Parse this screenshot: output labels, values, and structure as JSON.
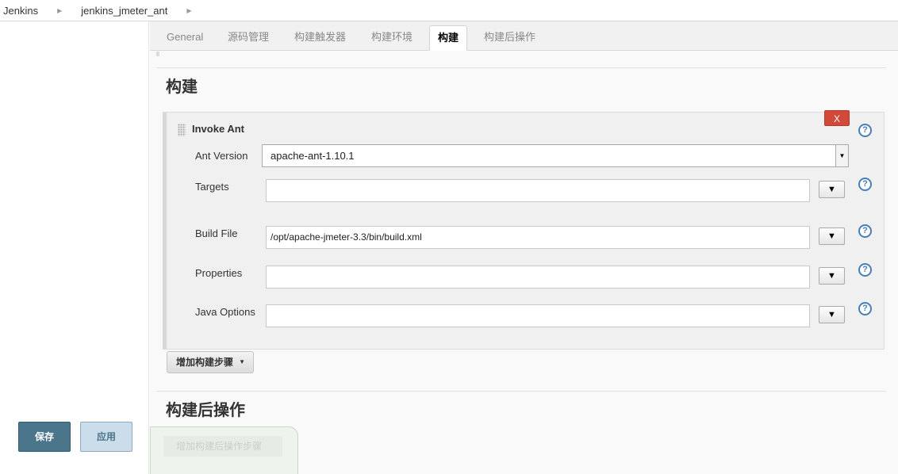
{
  "breadcrumb": {
    "items": [
      "Jenkins",
      "jenkins_jmeter_ant"
    ]
  },
  "tabs": [
    "General",
    "源码管理",
    "构建触发器",
    "构建环境",
    "构建",
    "构建后操作"
  ],
  "active_tab": "构建",
  "build_section": {
    "title": "构建"
  },
  "step": {
    "title": "Invoke Ant",
    "delete_label": "X",
    "help_glyph": "?",
    "expand_glyph": "▼",
    "fields": {
      "ant_version": {
        "label": "Ant Version",
        "value": "apache-ant-1.10.1"
      },
      "targets": {
        "label": "Targets",
        "value": ""
      },
      "build_file": {
        "label": "Build File",
        "value": "/opt/apache-jmeter-3.3/bin/build.xml"
      },
      "properties": {
        "label": "Properties",
        "value": ""
      },
      "java_options": {
        "label": "Java Options",
        "value": ""
      }
    }
  },
  "add_build_step_label": "增加构建步骤",
  "post_build_section": {
    "title": "构建后操作"
  },
  "add_post_build_label": "增加构建后操作步骤",
  "actions": {
    "save": "保存",
    "apply": "应用"
  },
  "colors": {
    "delete": "#d24939",
    "save": "#4b758b",
    "apply_bg": "#cbdcea",
    "help": "#4a7fb5"
  }
}
